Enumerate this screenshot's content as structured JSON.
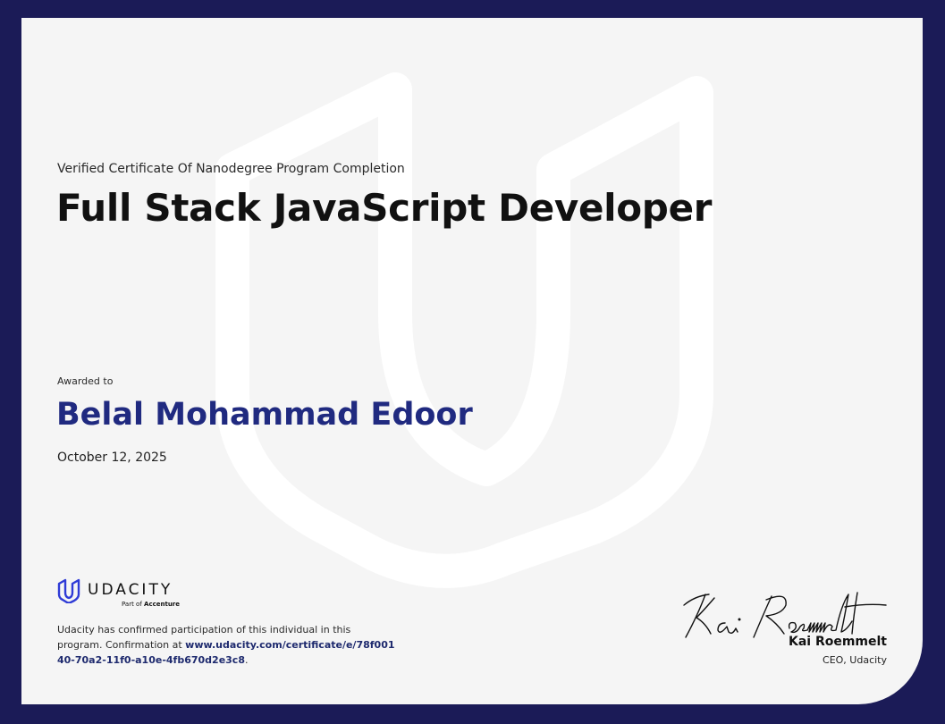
{
  "certificate": {
    "subtitle": "Verified Certificate Of Nanodegree Program Completion",
    "program_title": "Full Stack JavaScript Developer",
    "awarded_label": "Awarded to",
    "recipient_name": "Belal Mohammad Edoor",
    "date": "October 12, 2025"
  },
  "branding": {
    "logo_word": "UDACITY",
    "logo_sub_prefix": "Part of",
    "logo_sub_brand": "Accenture",
    "logo_icon": "udacity-u-icon",
    "watermark_icon": "udacity-u-watermark",
    "accent_color": "#202a80",
    "frame_color": "#1b1b57",
    "logo_color": "#2f3bd6"
  },
  "confirmation": {
    "text": "Udacity has confirmed participation of this individual in this program. Confirmation at",
    "url": "www.udacity.com/certificate/e/78f00140-70a2-11f0-a10e-4fb670d2e3c8",
    "suffix": "."
  },
  "signatory": {
    "signature_text": "Kai Roemmelt",
    "name": "Kai Roemmelt",
    "role": "CEO, Udacity"
  }
}
